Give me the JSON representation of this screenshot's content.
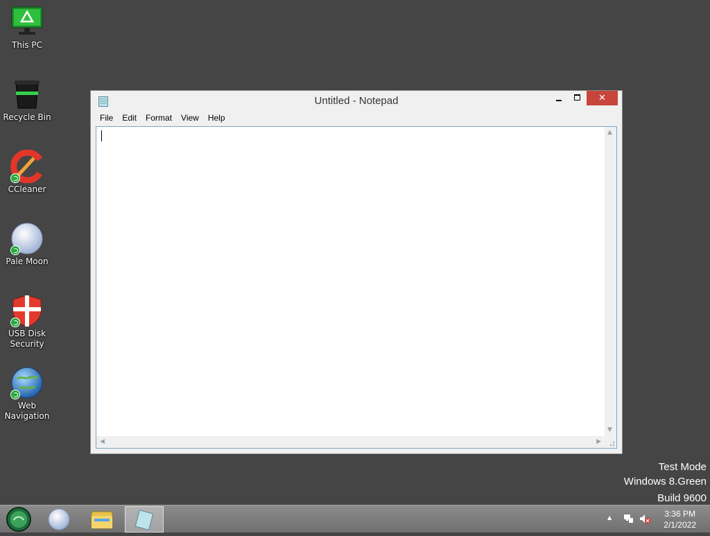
{
  "desktop": {
    "icons": [
      {
        "label": "This PC",
        "icon": "this-pc-icon"
      },
      {
        "label": "Recycle Bin",
        "icon": "recycle-bin-icon"
      },
      {
        "label": "CCleaner",
        "icon": "ccleaner-icon"
      },
      {
        "label": "Pale Moon",
        "icon": "pale-moon-icon"
      },
      {
        "label": "USB Disk\nSecurity",
        "icon": "usb-disk-security-icon"
      },
      {
        "label": "Web\nNavigation",
        "icon": "web-navigation-icon"
      }
    ],
    "watermark": {
      "line1": "Test Mode",
      "line2": "Windows 8.Green",
      "line3": "Build 9600"
    }
  },
  "notepad": {
    "title": "Untitled - Notepad",
    "close_glyph": "✕",
    "menu": [
      "File",
      "Edit",
      "Format",
      "View",
      "Help"
    ],
    "content": ""
  },
  "taskbar": {
    "items": [
      "start-orb-icon",
      "pale-moon-icon",
      "file-explorer-icon",
      "notepad-icon"
    ],
    "active_item": "notepad-icon",
    "tray_arrow": "▲",
    "clock": {
      "time": "3:36 PM",
      "date": "2/1/2022"
    }
  },
  "colors": {
    "desktop": "#454545",
    "close_button": "#c7453b",
    "accent": "#7aa4c7"
  }
}
